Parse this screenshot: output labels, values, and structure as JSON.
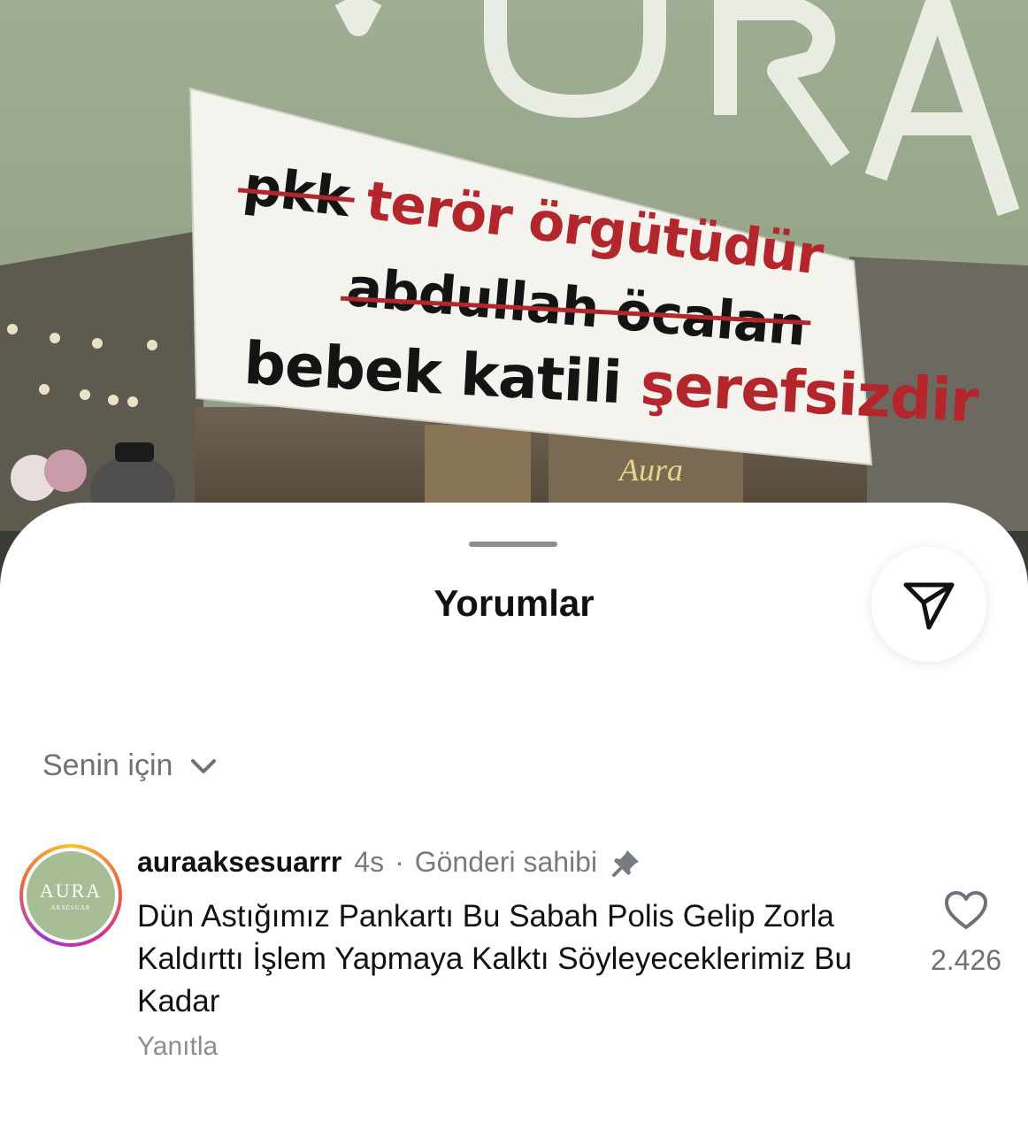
{
  "photo": {
    "sign_letters": "URA",
    "banner": {
      "line1_struck": "pkk",
      "line1_rest": "terör örgütüdür",
      "line2_struck": "abdullah öcalan",
      "line3_dark": "bebek katili",
      "line3_red": "şerefsizdir"
    },
    "window_logo": "Aura",
    "colors": {
      "banner_red": "#b3262b",
      "facade": "#a9b69a"
    }
  },
  "sheet": {
    "title": "Yorumlar",
    "share_icon": "paper-plane-icon",
    "filter": {
      "label": "Senin için",
      "icon": "chevron-down-icon"
    }
  },
  "comment": {
    "avatar": {
      "logo_text": "AURA",
      "logo_sub": "AKSESUAR"
    },
    "username": "auraaksesuarrr",
    "time": "4s",
    "separator": "·",
    "role": "Gönderi sahibi",
    "pin_icon": "pin-icon",
    "text": "Dün Astığımız Pankartı Bu Sabah Polis Gelip Zorla Kaldırttı İşlem Yapmaya Kalktı Söyleyeceklerimiz Bu Kadar",
    "reply_label": "Yanıtla",
    "like_icon": "heart-icon",
    "like_count": "2.426"
  }
}
